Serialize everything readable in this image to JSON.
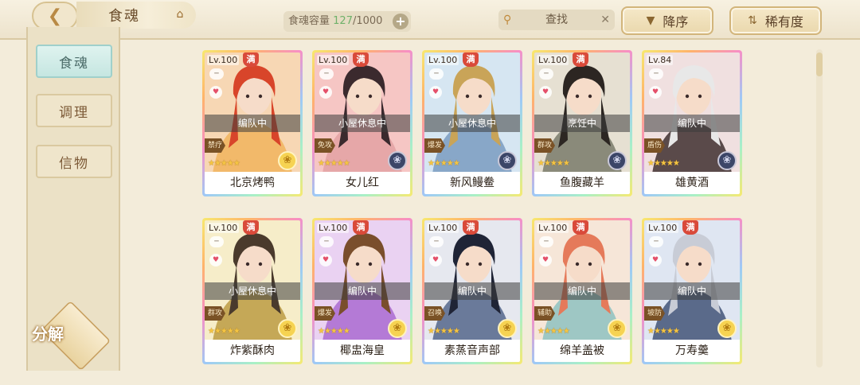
{
  "header": {
    "back_icon": "back-arrow-icon",
    "title": "食魂",
    "home_icon": "home-icon",
    "capacity_label": "食魂容量",
    "capacity_current": "127",
    "capacity_max": "/1000",
    "capacity_add": "+",
    "search_label": "查找",
    "sort_label": "降序",
    "rarity_label": "稀有度"
  },
  "sidebar": {
    "tabs": [
      {
        "label": "食魂"
      },
      {
        "label": "调理"
      },
      {
        "label": "信物"
      }
    ],
    "decompose_label": "分解"
  },
  "cards": [
    {
      "level": "Lv.100",
      "full": "满",
      "status": "编队中",
      "role": "禁疗",
      "name": "北京烤鸭",
      "stars": 5,
      "badge": "light",
      "palette": [
        "#f7d7b4",
        "#d8452a",
        "#f2b96a"
      ]
    },
    {
      "level": "Lv.100",
      "full": "满",
      "status": "小屋休息中",
      "role": "免攻",
      "name": "女儿红",
      "stars": 5,
      "badge": "dark",
      "palette": [
        "#f6c6c4",
        "#3b2a2e",
        "#e6a7a8"
      ]
    },
    {
      "level": "Lv.100",
      "full": "满",
      "status": "小屋休息中",
      "role": "爆发",
      "name": "新风鳗鲞",
      "stars": 5,
      "badge": "dark",
      "palette": [
        "#d6e6f2",
        "#c9a458",
        "#88a7c8"
      ]
    },
    {
      "level": "Lv.100",
      "full": "满",
      "status": "烹饪中",
      "role": "群攻",
      "name": "鱼腹藏羊",
      "stars": 5,
      "badge": "dark",
      "palette": [
        "#e6e0d2",
        "#2c2622",
        "#8a8a7a"
      ]
    },
    {
      "level": "Lv.84",
      "full": "",
      "status": "编队中",
      "role": "盾伤",
      "name": "雄黄酒",
      "stars": 5,
      "badge": "dark",
      "palette": [
        "#f0e0e0",
        "#e8e8e8",
        "#5a4a4a"
      ]
    },
    {
      "level": "Lv.100",
      "full": "满",
      "status": "小屋休息中",
      "role": "群攻",
      "name": "炸紫酥肉",
      "stars": 5,
      "badge": "light",
      "palette": [
        "#f6edc9",
        "#4a3a2c",
        "#c5a857"
      ]
    },
    {
      "level": "Lv.100",
      "full": "满",
      "status": "编队中",
      "role": "爆发",
      "name": "椰盅海皇",
      "stars": 5,
      "badge": "light",
      "palette": [
        "#ead2f2",
        "#7a4e2c",
        "#b47ad6"
      ]
    },
    {
      "level": "Lv.100",
      "full": "满",
      "status": "编队中",
      "role": "召唤",
      "name": "素蒸音声部",
      "stars": 5,
      "badge": "light",
      "palette": [
        "#e6e8ef",
        "#1f2436",
        "#6a7a9a"
      ]
    },
    {
      "level": "Lv.100",
      "full": "满",
      "status": "编队中",
      "role": "辅助",
      "name": "绵羊盖被",
      "stars": 5,
      "badge": "light",
      "palette": [
        "#f6e6d8",
        "#e57a5a",
        "#9ec7c4"
      ]
    },
    {
      "level": "Lv.100",
      "full": "满",
      "status": "编队中",
      "role": "坡防",
      "name": "万寿羹",
      "stars": 5,
      "badge": "light",
      "palette": [
        "#dfe6f2",
        "#c8ccd6",
        "#5a6a8a"
      ]
    }
  ]
}
